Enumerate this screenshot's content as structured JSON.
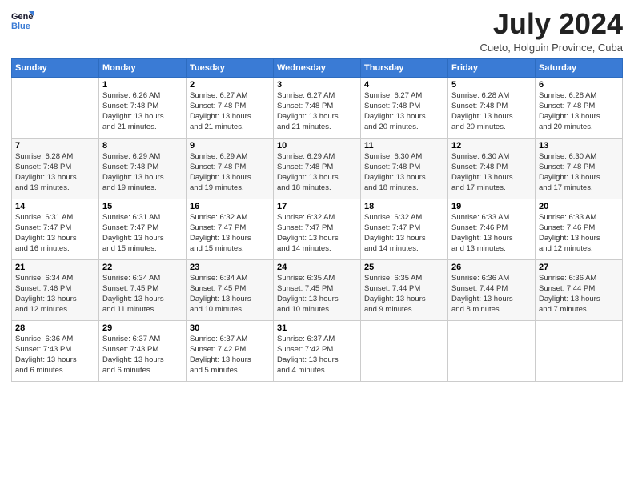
{
  "logo": {
    "line1": "General",
    "line2": "Blue"
  },
  "title": "July 2024",
  "subtitle": "Cueto, Holguin Province, Cuba",
  "header_days": [
    "Sunday",
    "Monday",
    "Tuesday",
    "Wednesday",
    "Thursday",
    "Friday",
    "Saturday"
  ],
  "weeks": [
    [
      {
        "day": "",
        "info": ""
      },
      {
        "day": "1",
        "info": "Sunrise: 6:26 AM\nSunset: 7:48 PM\nDaylight: 13 hours\nand 21 minutes."
      },
      {
        "day": "2",
        "info": "Sunrise: 6:27 AM\nSunset: 7:48 PM\nDaylight: 13 hours\nand 21 minutes."
      },
      {
        "day": "3",
        "info": "Sunrise: 6:27 AM\nSunset: 7:48 PM\nDaylight: 13 hours\nand 21 minutes."
      },
      {
        "day": "4",
        "info": "Sunrise: 6:27 AM\nSunset: 7:48 PM\nDaylight: 13 hours\nand 20 minutes."
      },
      {
        "day": "5",
        "info": "Sunrise: 6:28 AM\nSunset: 7:48 PM\nDaylight: 13 hours\nand 20 minutes."
      },
      {
        "day": "6",
        "info": "Sunrise: 6:28 AM\nSunset: 7:48 PM\nDaylight: 13 hours\nand 20 minutes."
      }
    ],
    [
      {
        "day": "7",
        "info": "Sunrise: 6:28 AM\nSunset: 7:48 PM\nDaylight: 13 hours\nand 19 minutes."
      },
      {
        "day": "8",
        "info": "Sunrise: 6:29 AM\nSunset: 7:48 PM\nDaylight: 13 hours\nand 19 minutes."
      },
      {
        "day": "9",
        "info": "Sunrise: 6:29 AM\nSunset: 7:48 PM\nDaylight: 13 hours\nand 19 minutes."
      },
      {
        "day": "10",
        "info": "Sunrise: 6:29 AM\nSunset: 7:48 PM\nDaylight: 13 hours\nand 18 minutes."
      },
      {
        "day": "11",
        "info": "Sunrise: 6:30 AM\nSunset: 7:48 PM\nDaylight: 13 hours\nand 18 minutes."
      },
      {
        "day": "12",
        "info": "Sunrise: 6:30 AM\nSunset: 7:48 PM\nDaylight: 13 hours\nand 17 minutes."
      },
      {
        "day": "13",
        "info": "Sunrise: 6:30 AM\nSunset: 7:48 PM\nDaylight: 13 hours\nand 17 minutes."
      }
    ],
    [
      {
        "day": "14",
        "info": "Sunrise: 6:31 AM\nSunset: 7:47 PM\nDaylight: 13 hours\nand 16 minutes."
      },
      {
        "day": "15",
        "info": "Sunrise: 6:31 AM\nSunset: 7:47 PM\nDaylight: 13 hours\nand 15 minutes."
      },
      {
        "day": "16",
        "info": "Sunrise: 6:32 AM\nSunset: 7:47 PM\nDaylight: 13 hours\nand 15 minutes."
      },
      {
        "day": "17",
        "info": "Sunrise: 6:32 AM\nSunset: 7:47 PM\nDaylight: 13 hours\nand 14 minutes."
      },
      {
        "day": "18",
        "info": "Sunrise: 6:32 AM\nSunset: 7:47 PM\nDaylight: 13 hours\nand 14 minutes."
      },
      {
        "day": "19",
        "info": "Sunrise: 6:33 AM\nSunset: 7:46 PM\nDaylight: 13 hours\nand 13 minutes."
      },
      {
        "day": "20",
        "info": "Sunrise: 6:33 AM\nSunset: 7:46 PM\nDaylight: 13 hours\nand 12 minutes."
      }
    ],
    [
      {
        "day": "21",
        "info": "Sunrise: 6:34 AM\nSunset: 7:46 PM\nDaylight: 13 hours\nand 12 minutes."
      },
      {
        "day": "22",
        "info": "Sunrise: 6:34 AM\nSunset: 7:45 PM\nDaylight: 13 hours\nand 11 minutes."
      },
      {
        "day": "23",
        "info": "Sunrise: 6:34 AM\nSunset: 7:45 PM\nDaylight: 13 hours\nand 10 minutes."
      },
      {
        "day": "24",
        "info": "Sunrise: 6:35 AM\nSunset: 7:45 PM\nDaylight: 13 hours\nand 10 minutes."
      },
      {
        "day": "25",
        "info": "Sunrise: 6:35 AM\nSunset: 7:44 PM\nDaylight: 13 hours\nand 9 minutes."
      },
      {
        "day": "26",
        "info": "Sunrise: 6:36 AM\nSunset: 7:44 PM\nDaylight: 13 hours\nand 8 minutes."
      },
      {
        "day": "27",
        "info": "Sunrise: 6:36 AM\nSunset: 7:44 PM\nDaylight: 13 hours\nand 7 minutes."
      }
    ],
    [
      {
        "day": "28",
        "info": "Sunrise: 6:36 AM\nSunset: 7:43 PM\nDaylight: 13 hours\nand 6 minutes."
      },
      {
        "day": "29",
        "info": "Sunrise: 6:37 AM\nSunset: 7:43 PM\nDaylight: 13 hours\nand 6 minutes."
      },
      {
        "day": "30",
        "info": "Sunrise: 6:37 AM\nSunset: 7:42 PM\nDaylight: 13 hours\nand 5 minutes."
      },
      {
        "day": "31",
        "info": "Sunrise: 6:37 AM\nSunset: 7:42 PM\nDaylight: 13 hours\nand 4 minutes."
      },
      {
        "day": "",
        "info": ""
      },
      {
        "day": "",
        "info": ""
      },
      {
        "day": "",
        "info": ""
      }
    ]
  ]
}
